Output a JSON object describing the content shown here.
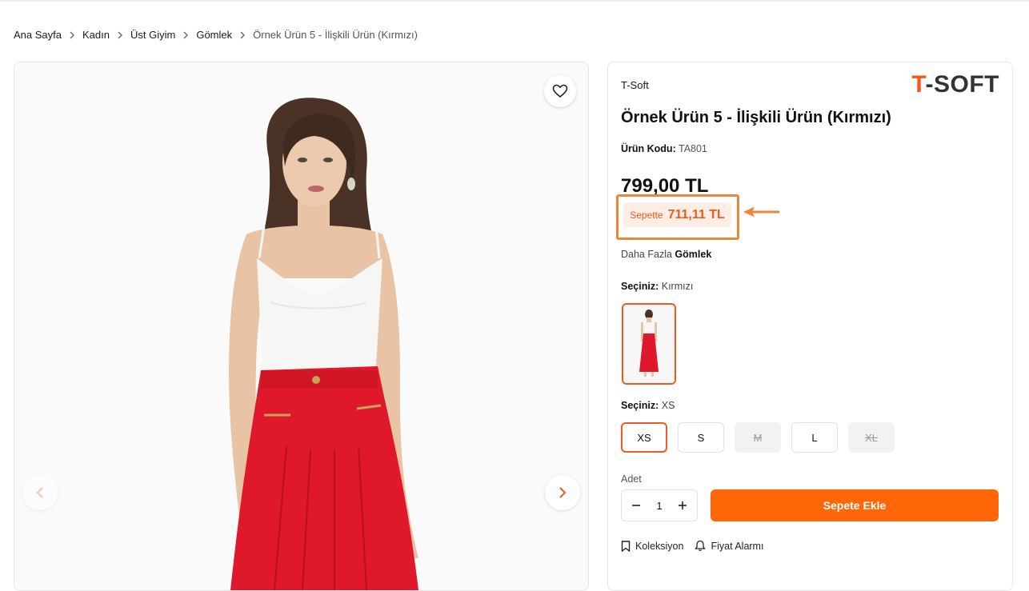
{
  "breadcrumb": [
    "Ana Sayfa",
    "Kadın",
    "Üst Giyim",
    "Gömlek",
    "Örnek Ürün 5 - İlişkili Ürün (Kırmızı)"
  ],
  "product": {
    "brand": "T-Soft",
    "logo_left": "T",
    "logo_right": "-SOFT",
    "title": "Örnek Ürün 5 - İlişkili Ürün (Kırmızı)",
    "code_label": "Ürün Kodu:",
    "code_value": "TA801",
    "price": "799,00 TL",
    "cart_price_label": "Sepette",
    "cart_price_value": "711,11 TL",
    "more_prefix": "Daha Fazla",
    "more_category": "Gömlek"
  },
  "variants": {
    "color_label": "Seçiniz:",
    "color_value": "Kırmızı",
    "size_label": "Seçiniz:",
    "size_value": "XS",
    "sizes": [
      {
        "label": "XS",
        "state": "selected"
      },
      {
        "label": "S",
        "state": "available"
      },
      {
        "label": "M",
        "state": "disabled"
      },
      {
        "label": "L",
        "state": "available"
      },
      {
        "label": "XL",
        "state": "disabled"
      }
    ]
  },
  "purchase": {
    "qty_label": "Adet",
    "qty_value": "1",
    "add_to_cart": "Sepete Ekle",
    "collection": "Koleksiyon",
    "price_alarm": "Fiyat Alarmı"
  },
  "icons": [
    "heart-icon",
    "chevron-left-icon",
    "chevron-right-icon",
    "chevron-breadcrumb-icon",
    "minus-icon",
    "plus-icon",
    "bookmark-icon",
    "bell-icon",
    "annotation-arrow-icon"
  ],
  "colors": {
    "accent": "#ff6608",
    "annotation": "#ef8536",
    "pill_bg": "#fdeee5",
    "skirt": "#e0182b"
  }
}
